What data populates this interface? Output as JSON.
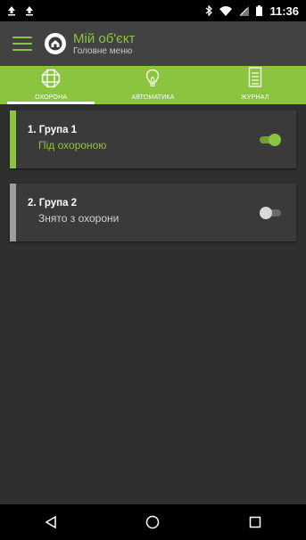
{
  "statusbar": {
    "time": "11:36",
    "icons": [
      "upload-icon",
      "upload-icon",
      "bluetooth-icon",
      "wifi-icon",
      "signal-icon",
      "battery-icon"
    ]
  },
  "appbar": {
    "title": "Мій об'єкт",
    "subtitle": "Головне меню"
  },
  "tabs": [
    {
      "label": "ОХОРОНА",
      "icon": "shield-grid-icon",
      "active": true
    },
    {
      "label": "АВТОМАТИКА",
      "icon": "lightbulb-icon",
      "active": false
    },
    {
      "label": "ЖУРНАЛ",
      "icon": "journal-icon",
      "active": false
    }
  ],
  "groups": [
    {
      "title": "1. Група 1",
      "status": "Під охороною",
      "armed": true
    },
    {
      "title": "2. Група 2",
      "status": "Знято з охорони",
      "armed": false
    }
  ],
  "colors": {
    "accent": "#8bc53f",
    "disarmed_stripe": "#9e9e9e",
    "disarmed_text": "#d0d0d0",
    "card_bg": "#3a3a3a",
    "page_bg": "#2f2f2f",
    "appbar_bg": "#424242"
  },
  "navbar": [
    "back-icon",
    "home-circle-icon",
    "recents-icon"
  ]
}
